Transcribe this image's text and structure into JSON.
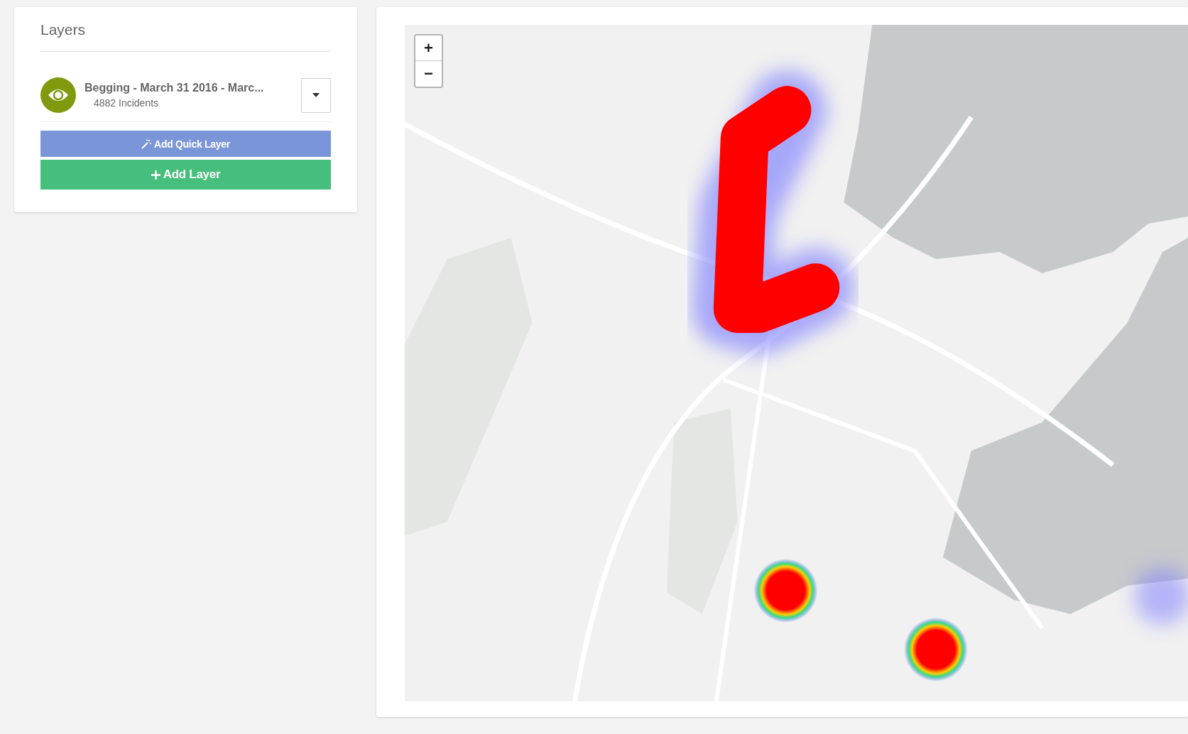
{
  "layers_panel": {
    "title": "Layers",
    "layers": [
      {
        "name": "Begging - March 31 2016 - Marc...",
        "count": "4882 Incidents",
        "visible": true,
        "color": "#7f9a0d"
      }
    ],
    "buttons": [
      {
        "kind": "quick",
        "label": "Add Quick Layer"
      },
      {
        "kind": "add",
        "label": "Add Layer"
      }
    ]
  },
  "map": {
    "kind": "picture",
    "zoom_controls": [
      "+",
      "−"
    ]
  }
}
